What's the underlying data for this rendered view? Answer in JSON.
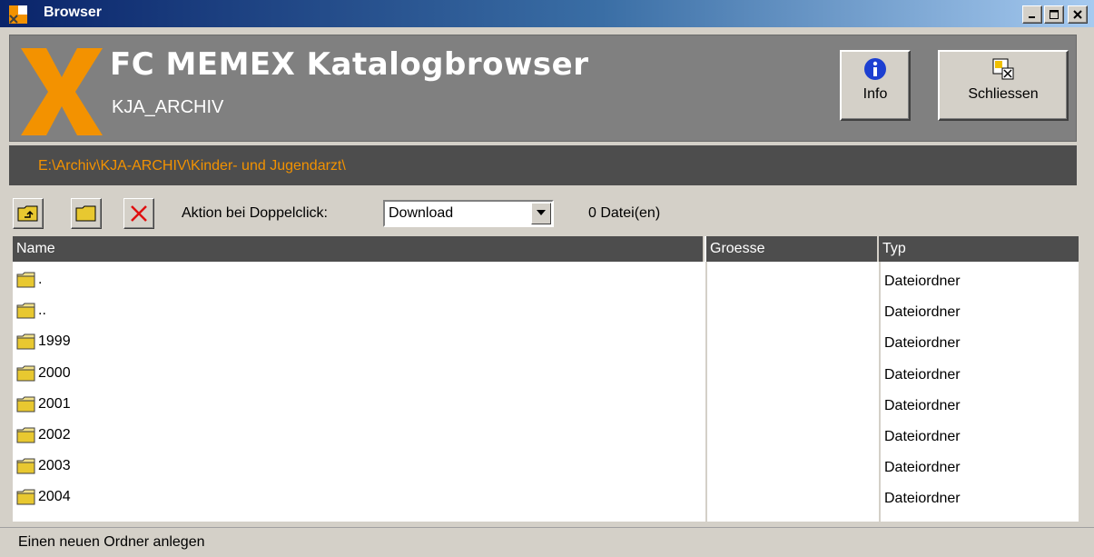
{
  "window": {
    "title": "Browser",
    "minimize": "minimize",
    "maximize": "maximize",
    "close": "close"
  },
  "header": {
    "app_title": "FC MEMEX Katalogbrowser",
    "archive_name": "KJA_ARCHIV",
    "info_label": "Info",
    "close_label": "Schliessen",
    "accent_color": "#f39200"
  },
  "path": {
    "current": "E:\\Archiv\\KJA-ARCHIV\\Kinder- und Jugendarzt\\"
  },
  "toolbar": {
    "up_icon": "folder-up-icon",
    "new_folder_icon": "new-folder-icon",
    "delete_icon": "delete-icon",
    "doubleclick_label": "Aktion bei Doppelclick:",
    "doubleclick_value": "Download",
    "file_count": "0 Datei(en)"
  },
  "list": {
    "columns": {
      "name": "Name",
      "size": "Groesse",
      "type": "Typ"
    },
    "rows": [
      {
        "name": ".",
        "size": "",
        "type": "Dateiordner"
      },
      {
        "name": "..",
        "size": "",
        "type": "Dateiordner"
      },
      {
        "name": "1999",
        "size": "",
        "type": "Dateiordner"
      },
      {
        "name": "2000",
        "size": "",
        "type": "Dateiordner"
      },
      {
        "name": "2001",
        "size": "",
        "type": "Dateiordner"
      },
      {
        "name": "2002",
        "size": "",
        "type": "Dateiordner"
      },
      {
        "name": "2003",
        "size": "",
        "type": "Dateiordner"
      },
      {
        "name": "2004",
        "size": "",
        "type": "Dateiordner"
      }
    ]
  },
  "status": {
    "message": "Einen neuen Ordner anlegen"
  }
}
